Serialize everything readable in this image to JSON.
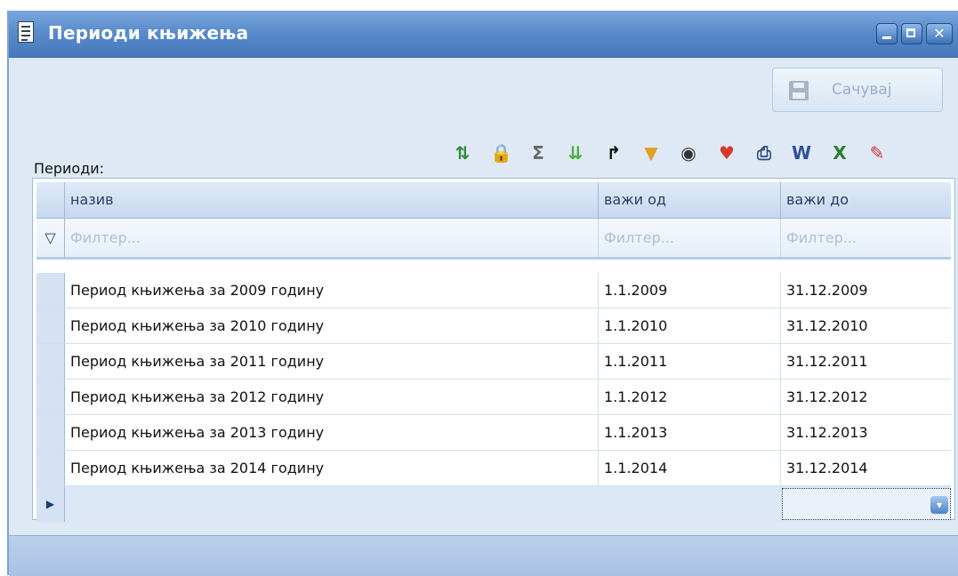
{
  "window": {
    "title": "Периоди књижења"
  },
  "toolbar": {
    "save_label": "Сачувај",
    "section_label": "Периоди:",
    "icons": [
      {
        "name": "refresh-icon",
        "glyph": "⇅",
        "color": "#2f8a3c"
      },
      {
        "name": "lock-icon",
        "glyph": "🔒",
        "color": "#2b2b2b"
      },
      {
        "name": "sum-icon",
        "glyph": "Σ",
        "color": "#666666"
      },
      {
        "name": "expand-down-icon",
        "glyph": "⇊",
        "color": "#4caf3a"
      },
      {
        "name": "go-to-icon",
        "glyph": "↱",
        "color": "#111111"
      },
      {
        "name": "filter-icon",
        "glyph": "▼",
        "color": "#e0a020"
      },
      {
        "name": "view-icon",
        "glyph": "◉",
        "color": "#333333"
      },
      {
        "name": "layout-icon",
        "glyph": "♥",
        "color": "#d83a2a"
      },
      {
        "name": "print-icon",
        "glyph": "⎙",
        "color": "#2a4a7a"
      },
      {
        "name": "export-word-icon",
        "glyph": "W",
        "color": "#2f4f9a"
      },
      {
        "name": "export-excel-icon",
        "glyph": "X",
        "color": "#2e7d32"
      },
      {
        "name": "export-pdf-icon",
        "glyph": "✎",
        "color": "#d32f2f"
      }
    ]
  },
  "grid": {
    "columns": [
      "назив",
      "важи од",
      "важи до"
    ],
    "filter_placeholder": "Филтер...",
    "rows": [
      {
        "name": "Период књижења за 2009 годину",
        "from": "1.1.2009",
        "to": "31.12.2009"
      },
      {
        "name": "Период књижења за 2010 годину",
        "from": "1.1.2010",
        "to": "31.12.2010"
      },
      {
        "name": "Период књижења за 2011 годину",
        "from": "1.1.2011",
        "to": "31.12.2011"
      },
      {
        "name": "Период књижења за 2012 годину",
        "from": "1.1.2012",
        "to": "31.12.2012"
      },
      {
        "name": "Период књижења за 2013 годину",
        "from": "1.1.2013",
        "to": "31.12.2013"
      },
      {
        "name": "Период књижења за 2014 годину",
        "from": "1.1.2014",
        "to": "31.12.2014"
      }
    ]
  },
  "colors": {
    "titlebar": "#5a8ccc",
    "grid_border": "#9db9dc"
  }
}
